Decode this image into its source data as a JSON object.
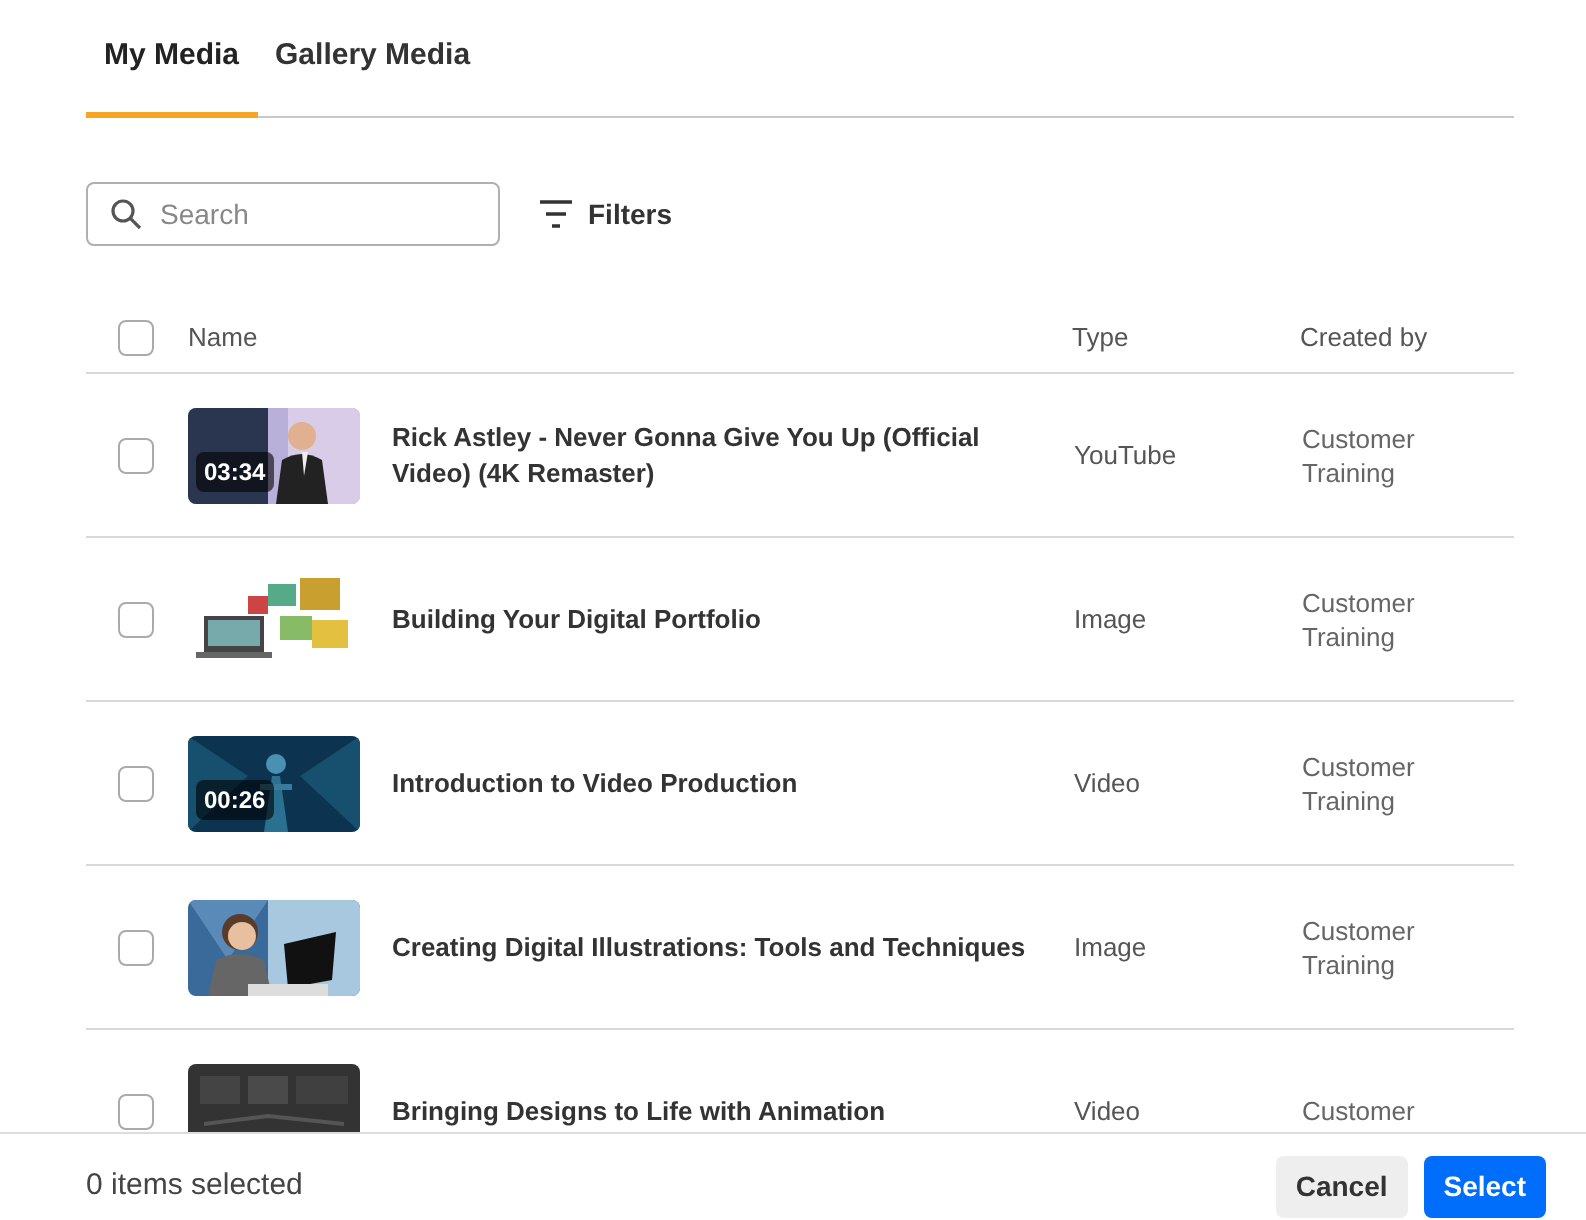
{
  "tabs": [
    {
      "label": "My Media",
      "selected": true
    },
    {
      "label": "Gallery Media",
      "selected": false
    }
  ],
  "search": {
    "placeholder": "Search"
  },
  "filters": {
    "label": "Filters"
  },
  "table": {
    "select_all": {
      "checked": false
    },
    "columns": [
      "Name",
      "Type",
      "Created by"
    ],
    "rows": [
      {
        "checked": false,
        "thumbnail": {
          "kind": "picture",
          "duration": "03:34"
        },
        "name": "Rick Astley - Never Gonna Give You Up (Official Video) (4K Remaster)",
        "type": "YouTube",
        "created_by": "Customer Training"
      },
      {
        "checked": false,
        "name": "Building Your Digital Portfolio",
        "type": "Image",
        "created_by": "Customer Training"
      },
      {
        "checked": false,
        "thumbnail": {
          "kind": "picture",
          "duration": "00:26"
        },
        "name": "Introduction to Video Production",
        "type": "Video",
        "created_by": "Customer Training"
      },
      {
        "checked": false,
        "name": "Creating Digital Illustrations: Tools and Techniques",
        "type": "Image",
        "created_by": "Customer Training"
      },
      {
        "checked": false,
        "name": "Bringing Designs to Life with Animation",
        "type": "Video",
        "created_by": "Customer"
      }
    ]
  },
  "footer": {
    "selection_count": "0 items selected",
    "buttons": [
      {
        "label": "Cancel",
        "kind": "secondary"
      },
      {
        "label": "Select",
        "kind": "primary"
      }
    ]
  }
}
